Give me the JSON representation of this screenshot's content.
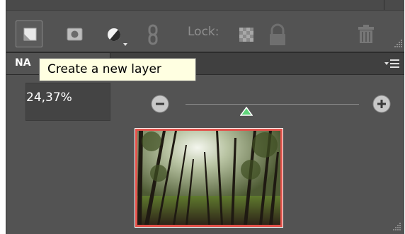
{
  "toolbar": {
    "new_layer_icon": "new-layer-icon",
    "mask_icon": "layer-mask-icon",
    "adjustment_icon": "adjustment-layer-icon",
    "link_icon": "link-icon",
    "lock_label": "Lock:",
    "lock_transparency_icon": "lock-transparency-icon",
    "lock_all_icon": "padlock-icon",
    "delete_icon": "trash-icon"
  },
  "tooltip": {
    "text": "Create a new layer"
  },
  "tab": {
    "label": "NAVIGATOR",
    "visible_label": "NA"
  },
  "navigator": {
    "zoom_value": "24,37%",
    "zoom_out_icon": "minus-circle-icon",
    "zoom_in_icon": "plus-circle-icon",
    "slider_level": 0.35,
    "preview": "forest-photo-thumbnail",
    "view_box_color": "#e2514a"
  },
  "colors": {
    "panel_bg": "#535353",
    "tooltip_bg": "#ffffe1",
    "accent_green": "#5fd47a"
  }
}
